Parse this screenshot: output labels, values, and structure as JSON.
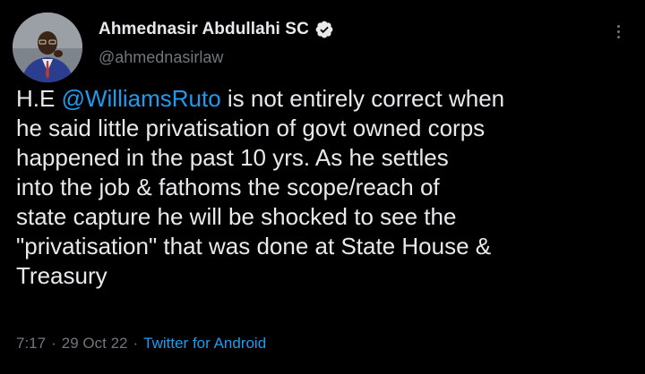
{
  "author": {
    "display_name": "Ahmednasir Abdullahi SC",
    "handle": "@ahmednasirlaw",
    "verified": true,
    "avatar_icon": "profile-photo"
  },
  "tweet": {
    "text_prefix": "H.E ",
    "mention": "@WilliamsRuto",
    "text_body": " is not entirely correct when\nhe said little privatisation of govt owned corps\nhappened in the past 10 yrs. As he settles\ninto the job & fathoms the scope/reach of\nstate capture he will be shocked to see the\n\"privatisation\" that was done at State House &\nTreasury"
  },
  "meta": {
    "time": "7:17",
    "separator": "·",
    "date": "29 Oct 22",
    "source": "Twitter for Android"
  },
  "colors": {
    "background": "#000000",
    "text": "#e7e9ea",
    "secondary": "#71767b",
    "accent": "#1d9bf0"
  }
}
